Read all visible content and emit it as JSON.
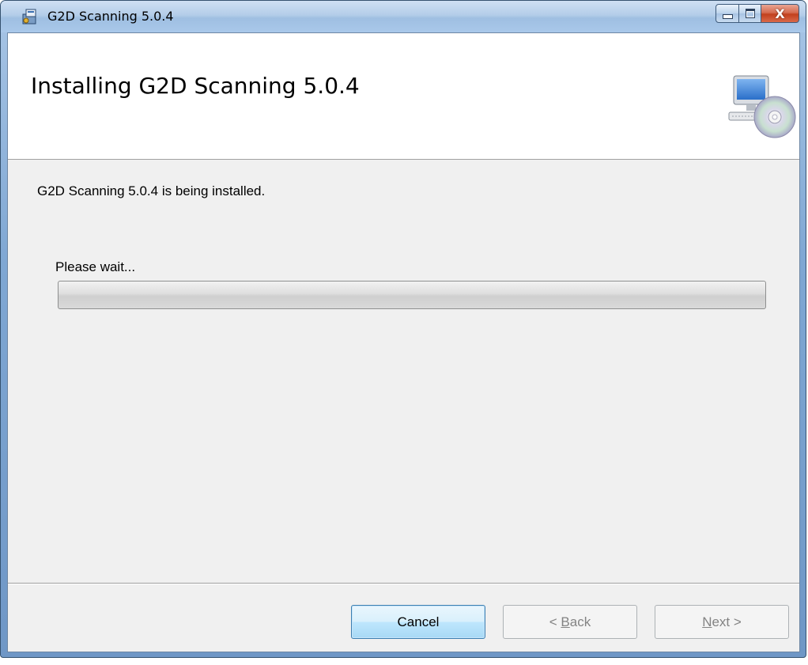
{
  "window": {
    "title": "G2D Scanning 5.0.4",
    "controls": {
      "minimize_icon": "minimize-icon",
      "maximize_icon": "maximize-icon",
      "close_icon": "close-icon",
      "close_label": "X"
    }
  },
  "banner": {
    "heading": "Installing G2D Scanning 5.0.4",
    "icon": "computer-cd-icon"
  },
  "main": {
    "status_text": "G2D Scanning 5.0.4 is being installed.",
    "wait_label": "Please wait...",
    "progress_fraction": 0
  },
  "buttons": {
    "cancel": "Cancel",
    "back": {
      "prefix": "< ",
      "accel": "B",
      "rest": "ack"
    },
    "next": {
      "accel": "N",
      "rest": "ext >"
    }
  },
  "colors": {
    "titlebar": "#b4cde9",
    "client_bg": "#f0f0f0",
    "close_button": "#c2401d",
    "default_button_border": "#3c7fb1"
  }
}
